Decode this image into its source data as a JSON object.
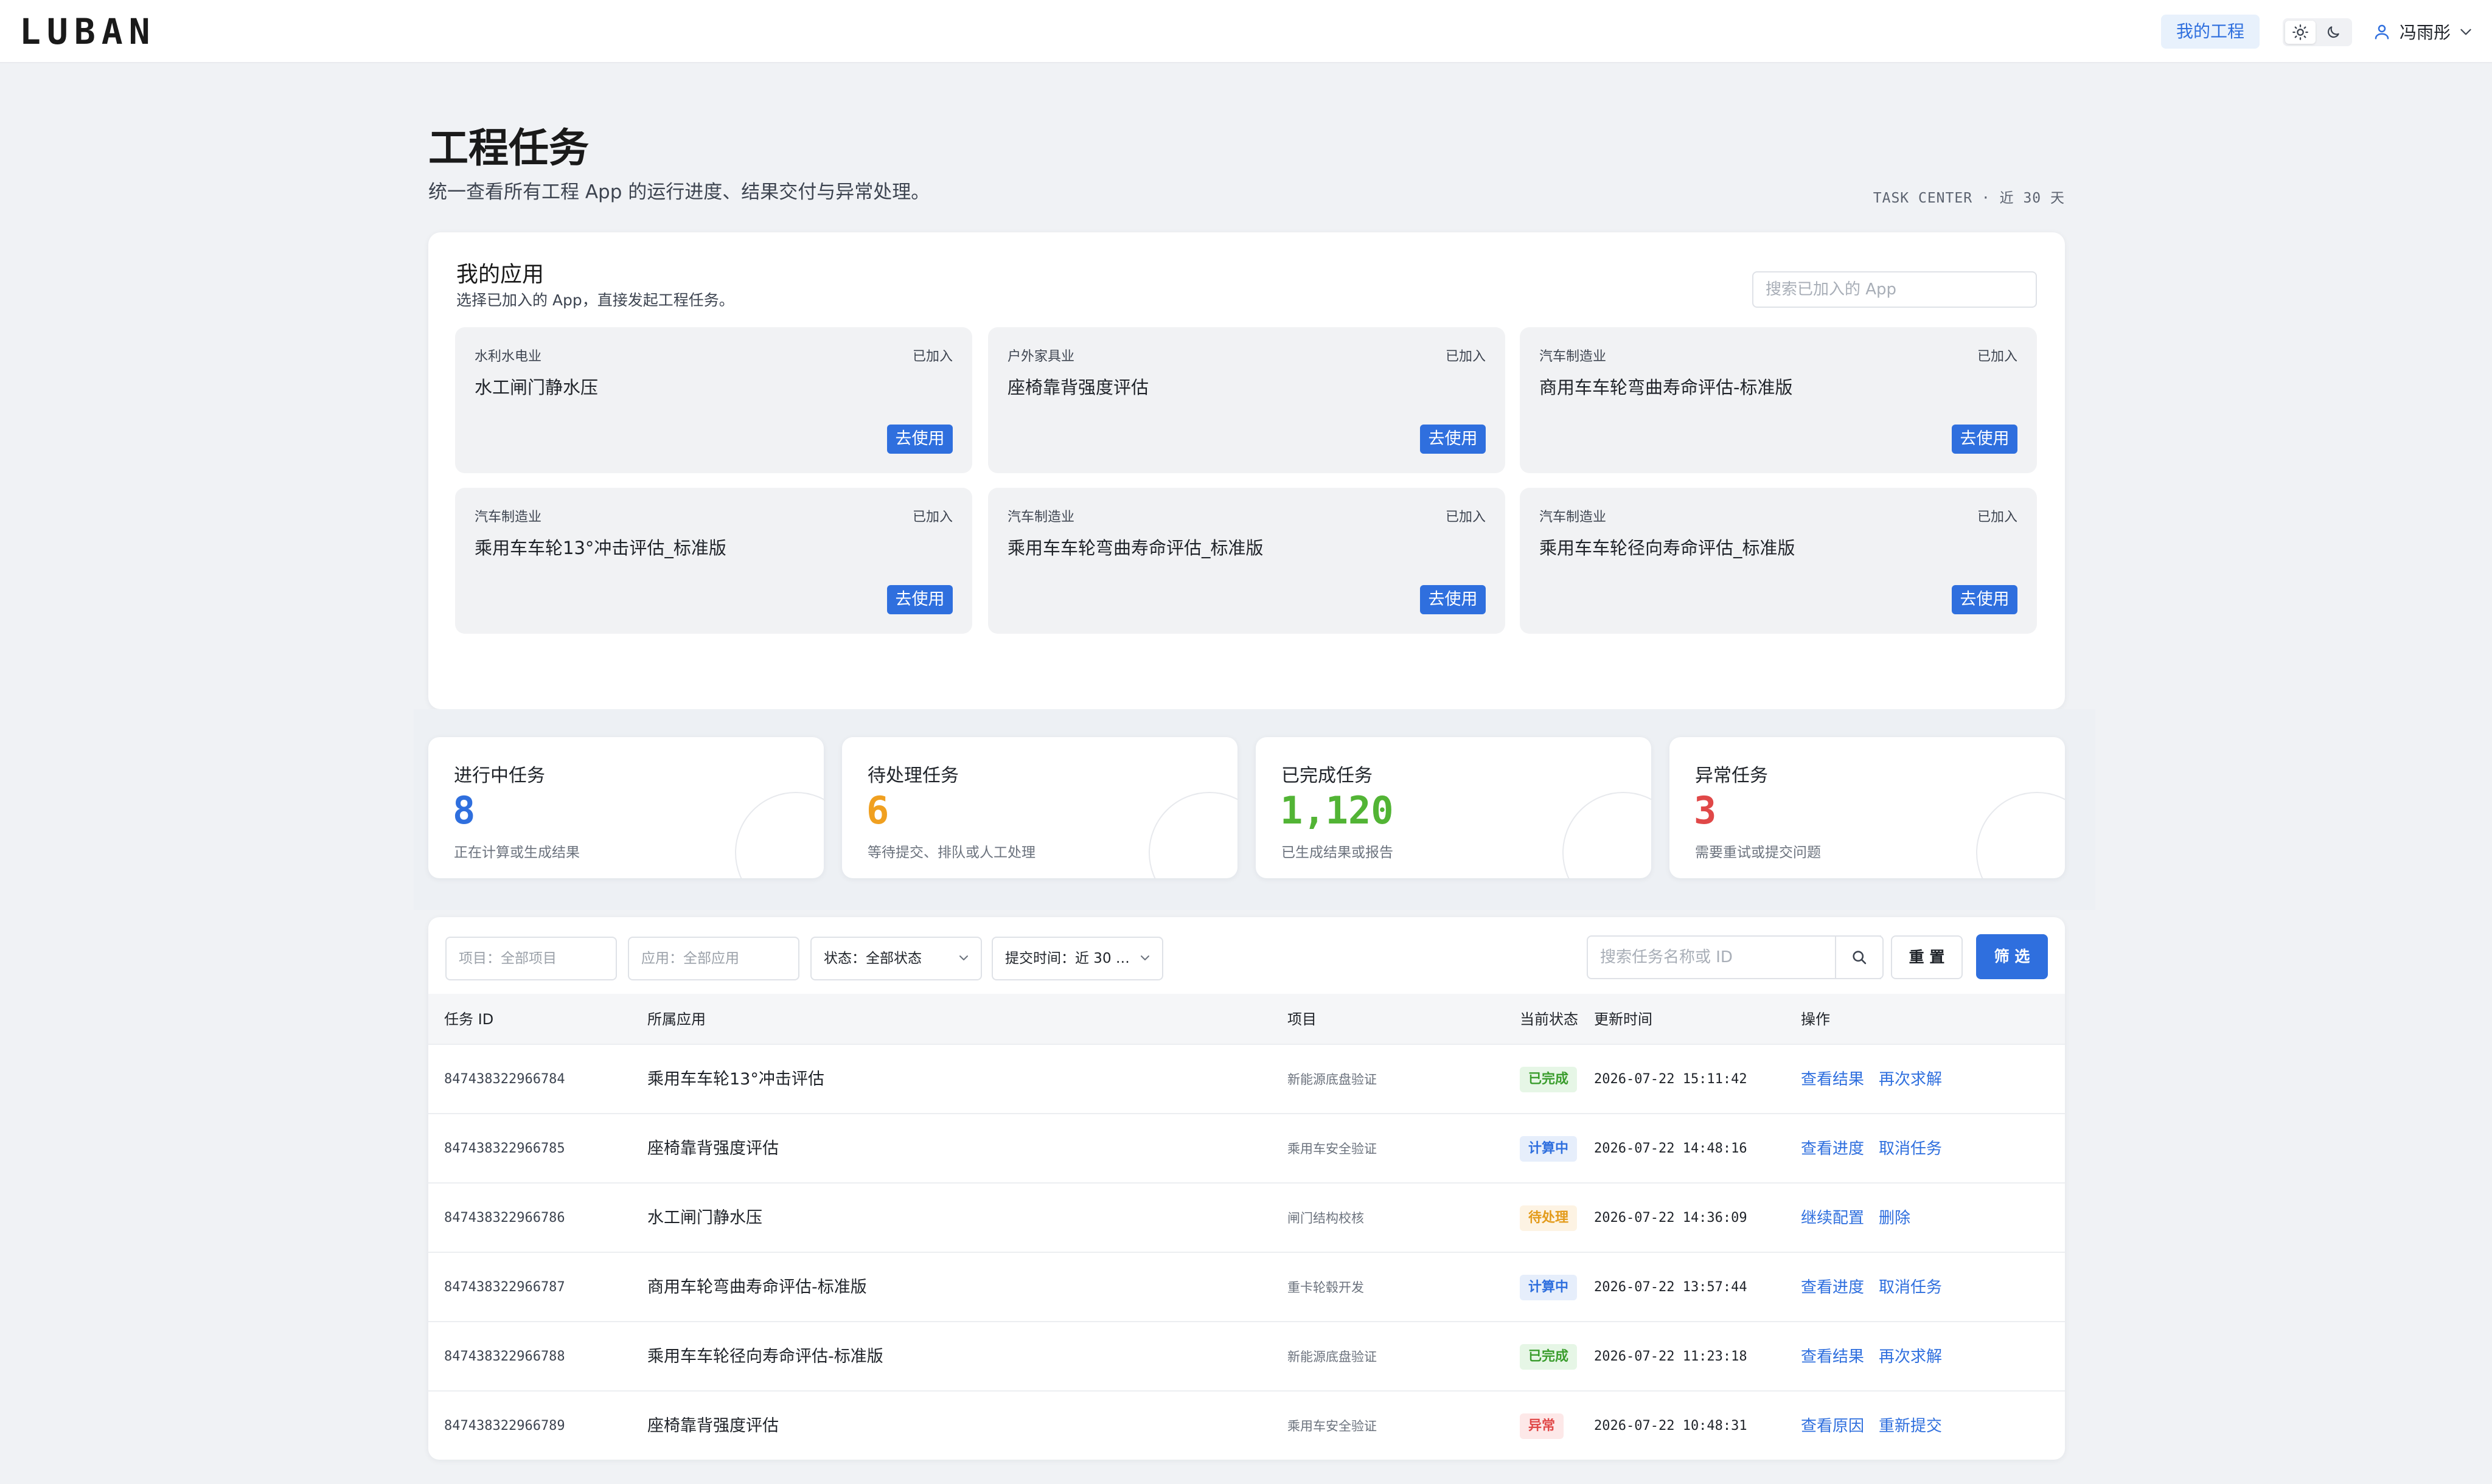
{
  "topbar": {
    "logo": "LUBAN",
    "my_project": "我的工程",
    "user_name": "冯雨彤"
  },
  "header": {
    "title": "工程任务",
    "subtitle": "统一查看所有工程 App 的运行进度、结果交付与异常处理。",
    "meta": "TASK CENTER · 近 30 天"
  },
  "apps": {
    "title": "我的应用",
    "desc": "选择已加入的 App，直接发起工程任务。",
    "search_placeholder": "搜索已加入的 App",
    "items": [
      {
        "industry": "水利水电业",
        "status": "已加入",
        "name": "水工闸门静水压",
        "action": "去使用"
      },
      {
        "industry": "户外家具业",
        "status": "已加入",
        "name": "座椅靠背强度评估",
        "action": "去使用"
      },
      {
        "industry": "汽车制造业",
        "status": "已加入",
        "name": "商用车车轮弯曲寿命评估-标准版",
        "action": "去使用"
      },
      {
        "industry": "汽车制造业",
        "status": "已加入",
        "name": "乘用车车轮13°冲击评估_标准版",
        "action": "去使用"
      },
      {
        "industry": "汽车制造业",
        "status": "已加入",
        "name": "乘用车车轮弯曲寿命评估_标准版",
        "action": "去使用"
      },
      {
        "industry": "汽车制造业",
        "status": "已加入",
        "name": "乘用车车轮径向寿命评估_标准版",
        "action": "去使用"
      }
    ]
  },
  "stats": [
    {
      "label": "进行中任务",
      "value": "8",
      "desc": "正在计算或生成结果",
      "color": "#2f6fde"
    },
    {
      "label": "待处理任务",
      "value": "6",
      "desc": "等待提交、排队或人工处理",
      "color": "#f0a020"
    },
    {
      "label": "已完成任务",
      "value": "1,120",
      "desc": "已生成结果或报告",
      "color": "#52b435"
    },
    {
      "label": "异常任务",
      "value": "3",
      "desc": "需要重试或提交问题",
      "color": "#e04848"
    }
  ],
  "filters": {
    "project": "项目：全部项目",
    "app": "应用：全部应用",
    "status": "状态：全部状态",
    "time": "提交时间：近 30 …",
    "search_placeholder": "搜索任务名称或 ID",
    "reset": "重 置",
    "filter": "筛 选"
  },
  "table": {
    "columns": [
      "任务 ID",
      "所属应用",
      "项目",
      "当前状态",
      "更新时间",
      "操作"
    ],
    "rows": [
      {
        "id": "847438322966784",
        "app": "乘用车车轮13°冲击评估",
        "project": "新能源底盘验证",
        "status": "已完成",
        "status_type": "done",
        "time": "2026-07-22 15:11:42",
        "action1": "查看结果",
        "action2": "再次求解"
      },
      {
        "id": "847438322966785",
        "app": "座椅靠背强度评估",
        "project": "乘用车安全验证",
        "status": "计算中",
        "status_type": "running",
        "time": "2026-07-22 14:48:16",
        "action1": "查看进度",
        "action2": "取消任务"
      },
      {
        "id": "847438322966786",
        "app": "水工闸门静水压",
        "project": "闸门结构校核",
        "status": "待处理",
        "status_type": "pending",
        "time": "2026-07-22 14:36:09",
        "action1": "继续配置",
        "action2": "删除"
      },
      {
        "id": "847438322966787",
        "app": "商用车轮弯曲寿命评估-标准版",
        "project": "重卡轮毂开发",
        "status": "计算中",
        "status_type": "running",
        "time": "2026-07-22 13:57:44",
        "action1": "查看进度",
        "action2": "取消任务"
      },
      {
        "id": "847438322966788",
        "app": "乘用车车轮径向寿命评估-标准版",
        "project": "新能源底盘验证",
        "status": "已完成",
        "status_type": "done",
        "time": "2026-07-22 11:23:18",
        "action1": "查看结果",
        "action2": "再次求解"
      },
      {
        "id": "847438322966789",
        "app": "座椅靠背强度评估",
        "project": "乘用车安全验证",
        "status": "异常",
        "status_type": "error",
        "time": "2026-07-22 10:48:31",
        "action1": "查看原因",
        "action2": "重新提交"
      }
    ]
  }
}
